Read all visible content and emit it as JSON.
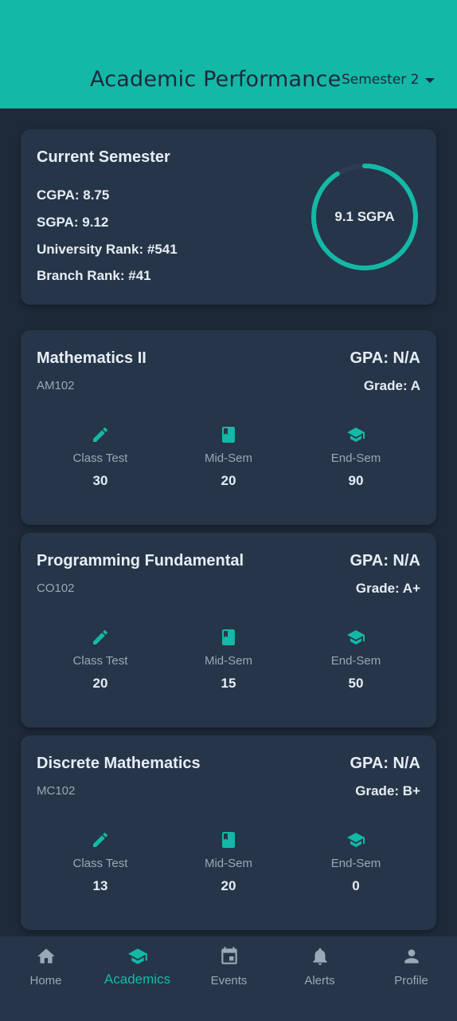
{
  "header": {
    "title": "Academic Performance",
    "semester_selected": "Semester 2"
  },
  "summary": {
    "title": "Current Semester",
    "cgpa": "CGPA: 8.75",
    "sgpa": "SGPA: 9.12",
    "university_rank": "University Rank: #541",
    "branch_rank": "Branch Rank: #41",
    "ring_label": "9.1 SGPA",
    "ring_fraction": 0.91
  },
  "marks_labels": {
    "class_test": "Class Test",
    "mid_sem": "Mid-Sem",
    "end_sem": "End-Sem"
  },
  "courses": [
    {
      "name": "Mathematics II",
      "code": "AM102",
      "gpa": "GPA: N/A",
      "grade": "Grade: A",
      "class_test": "30",
      "mid_sem": "20",
      "end_sem": "90"
    },
    {
      "name": "Programming Fundamental",
      "code": "CO102",
      "gpa": "GPA: N/A",
      "grade": "Grade: A+",
      "class_test": "20",
      "mid_sem": "15",
      "end_sem": "50"
    },
    {
      "name": "Discrete Mathematics",
      "code": "MC102",
      "gpa": "GPA: N/A",
      "grade": "Grade: B+",
      "class_test": "13",
      "mid_sem": "20",
      "end_sem": "0"
    }
  ],
  "nav": {
    "items": [
      {
        "label": "Home",
        "icon": "home-icon"
      },
      {
        "label": "Academics",
        "icon": "school-icon"
      },
      {
        "label": "Events",
        "icon": "calendar-icon"
      },
      {
        "label": "Alerts",
        "icon": "bell-icon"
      },
      {
        "label": "Profile",
        "icon": "person-icon"
      }
    ],
    "active": "Academics"
  },
  "colors": {
    "accent": "#14b8a6",
    "background": "#1e2a3a",
    "card": "#263548",
    "text": "#e6edf5",
    "muted": "#9aa8b8"
  }
}
